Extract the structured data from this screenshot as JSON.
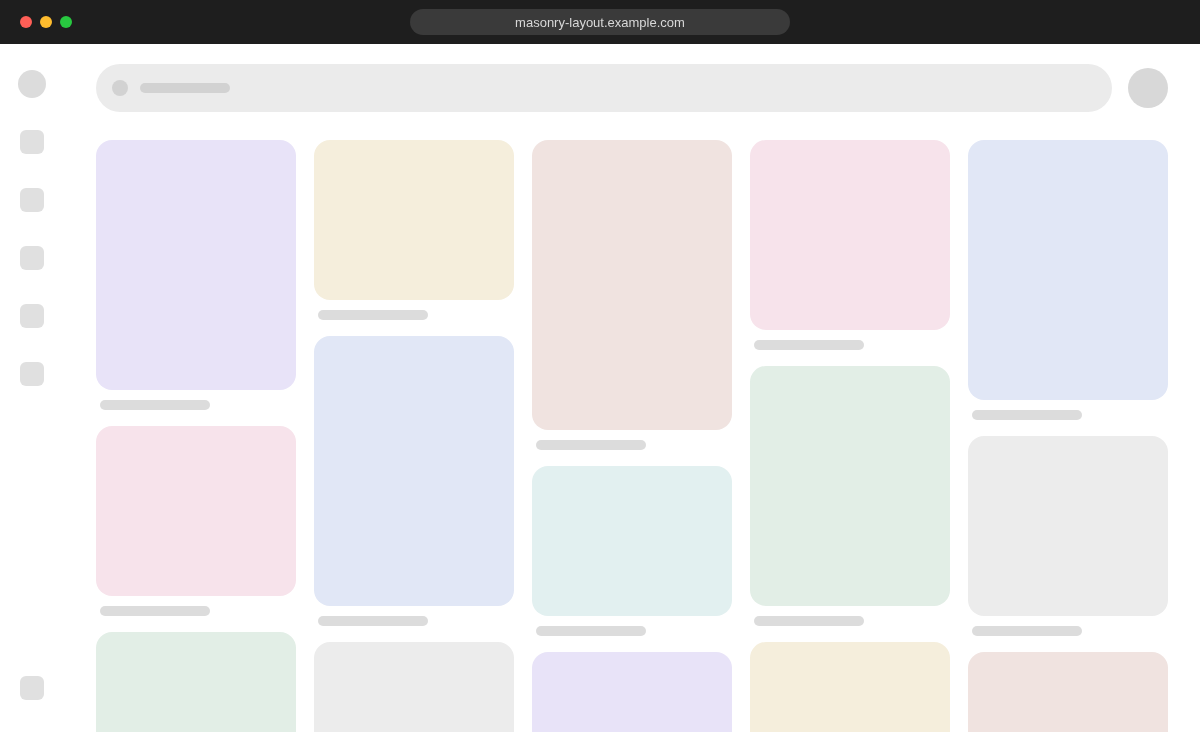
{
  "window": {
    "url": "masonry-layout.example.com"
  },
  "columns": [
    {
      "cards": [
        {
          "color": "#e8e3f8"
        },
        {
          "color": "#f7e3eb"
        },
        {
          "color": "#e2eee6"
        }
      ]
    },
    {
      "cards": [
        {
          "color": "#f5eedc"
        },
        {
          "color": "#e1e7f6"
        },
        {
          "color": "#ececec"
        }
      ]
    },
    {
      "cards": [
        {
          "color": "#f0e3e0"
        },
        {
          "color": "#e2f0f0"
        },
        {
          "color": "#e8e3f8"
        }
      ]
    },
    {
      "cards": [
        {
          "color": "#f7e3eb"
        },
        {
          "color": "#e2eee6"
        },
        {
          "color": "#f5eedc"
        }
      ]
    },
    {
      "cards": [
        {
          "color": "#e1e7f6"
        },
        {
          "color": "#ececec"
        },
        {
          "color": "#f0e3e0"
        }
      ]
    }
  ]
}
